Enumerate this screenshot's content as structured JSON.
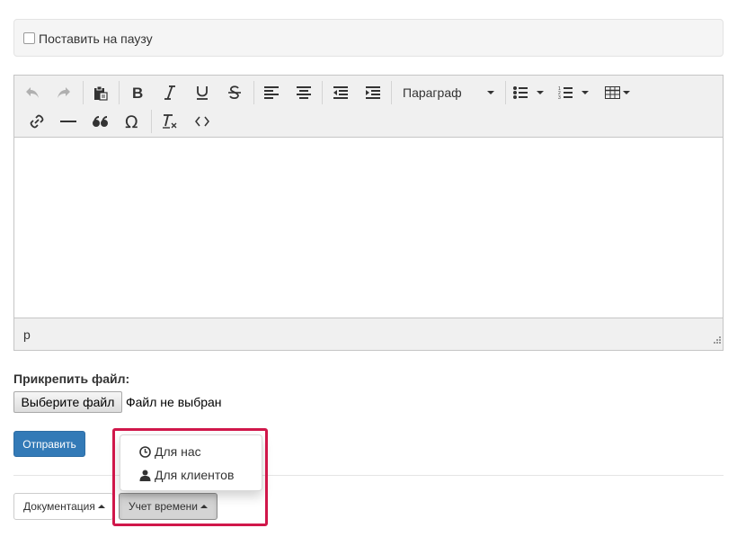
{
  "pause": {
    "label": "Поставить на паузу",
    "checked": false
  },
  "editor": {
    "toolbar": {
      "buttons": [
        "undo-icon",
        "redo-icon",
        "paste-icon",
        "bold-icon",
        "italic-icon",
        "underline-icon",
        "strikethrough-icon",
        "align-left-icon",
        "align-center-icon",
        "outdent-icon",
        "indent-icon",
        "bullet-list-icon",
        "numbered-list-icon",
        "table-icon",
        "link-icon",
        "horizontal-rule-icon",
        "blockquote-icon",
        "special-char-icon",
        "clear-format-icon",
        "code-icon"
      ],
      "format_select": "Параграф"
    },
    "statusbar": {
      "path": "p"
    }
  },
  "attach": {
    "label": "Прикрепить файл:",
    "choose_button": "Выберите файл",
    "status": "Файл не выбран"
  },
  "send_button": "Отправить",
  "bottom": {
    "docs_button": "Документация",
    "time_button": "Учет времени"
  },
  "time_menu": {
    "items": [
      {
        "icon": "clock-icon",
        "label": "Для нас"
      },
      {
        "icon": "user-icon",
        "label": "Для клиентов"
      }
    ]
  },
  "colors": {
    "primary": "#337ab7",
    "highlight": "#d0174a"
  }
}
